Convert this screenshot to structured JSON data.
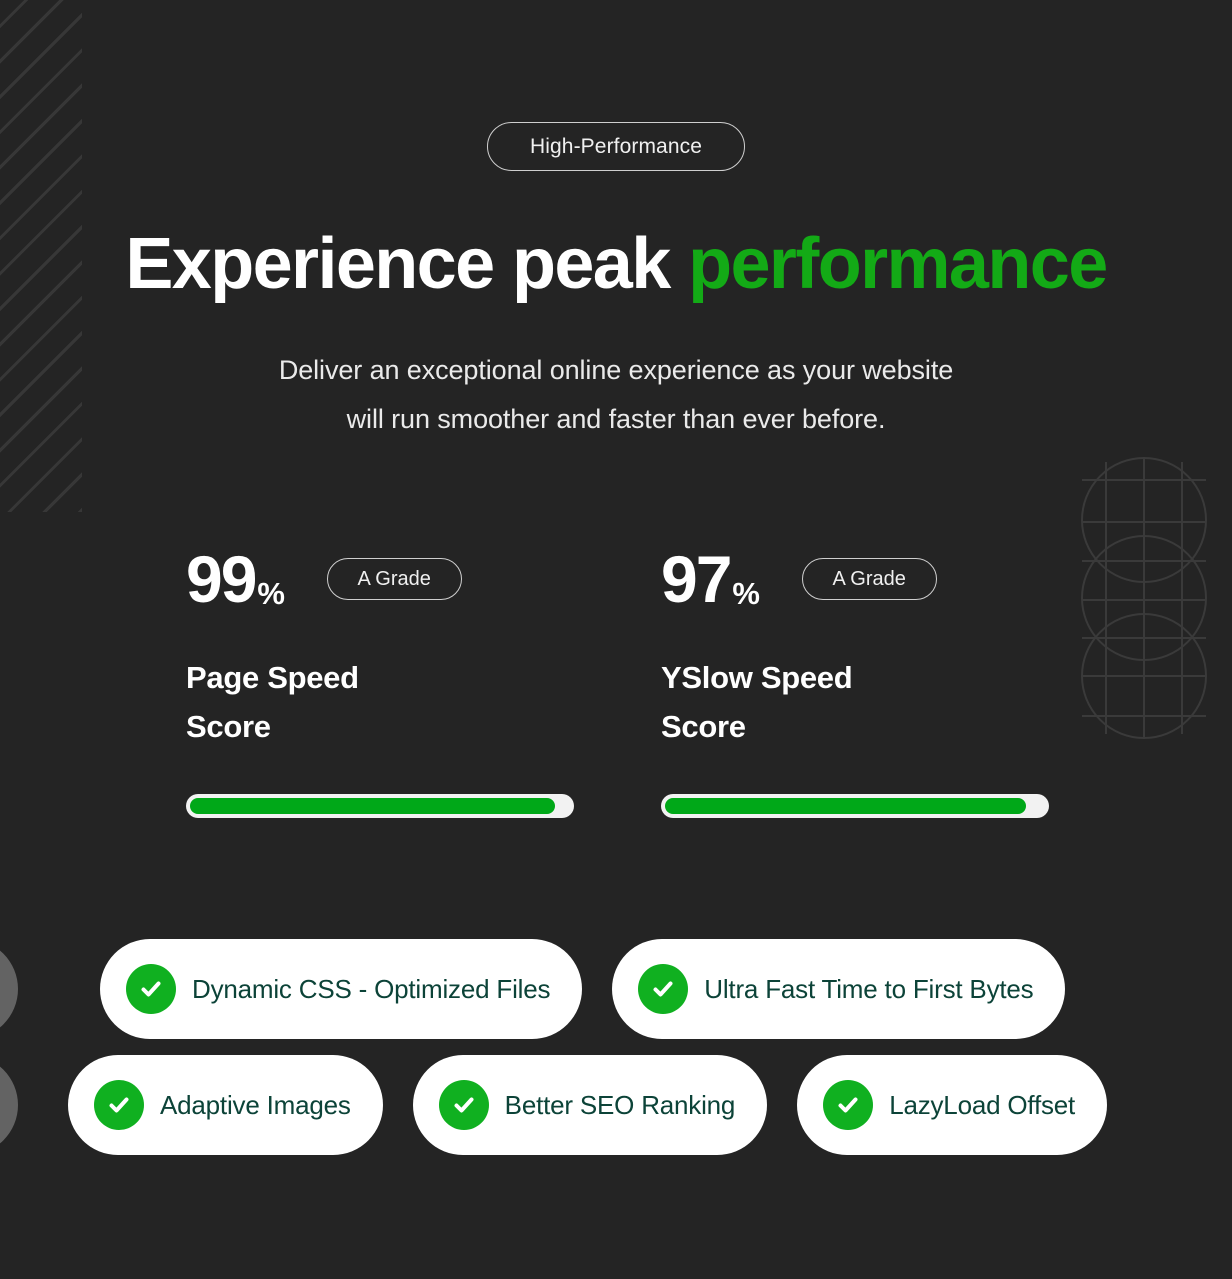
{
  "theme": {
    "background": "#242424",
    "accent_green": "#13aa16",
    "bar_green": "#00a818",
    "check_green": "#10b020",
    "pill_text": "#0c4338",
    "text_primary": "#ffffff",
    "text_secondary": "#eaeaea"
  },
  "hero": {
    "eyebrow": "High-Performance",
    "headline_plain": "Experience peak ",
    "headline_accent": "performance",
    "subtitle_line1": "Deliver an exceptional online experience as your website",
    "subtitle_line2": "will run smoother and faster than ever before."
  },
  "scores": [
    {
      "value": "99",
      "unit": "%",
      "grade": "A Grade",
      "label": "Page Speed Score",
      "progress_percent": 99
    },
    {
      "value": "97",
      "unit": "%",
      "grade": "A Grade",
      "label": "YSlow Speed Score",
      "progress_percent": 97
    }
  ],
  "features": {
    "row1": [
      {
        "label": "Dynamic CSS - Optimized Files",
        "icon": "check-circle-icon"
      },
      {
        "label": "Ultra Fast Time to First Bytes",
        "icon": "check-circle-icon"
      }
    ],
    "row2": [
      {
        "label": "Adaptive Images",
        "icon": "check-circle-icon"
      },
      {
        "label": "Better SEO Ranking",
        "icon": "check-circle-icon"
      },
      {
        "label": "LazyLoad Offset",
        "icon": "check-circle-icon"
      }
    ],
    "edge_row1_left": {
      "label": "",
      "icon": "check-circle-icon"
    },
    "edge_row1_right": {
      "label": "",
      "icon": "check-circle-icon"
    },
    "edge_row2_left": {
      "label": "",
      "icon": "check-circle-icon"
    },
    "edge_row2_right": {
      "label": "",
      "icon": "check-circle-icon"
    }
  },
  "decor": {
    "stripes": "diagonal-stripes-pattern",
    "orbs": "grid-circles-pattern"
  }
}
